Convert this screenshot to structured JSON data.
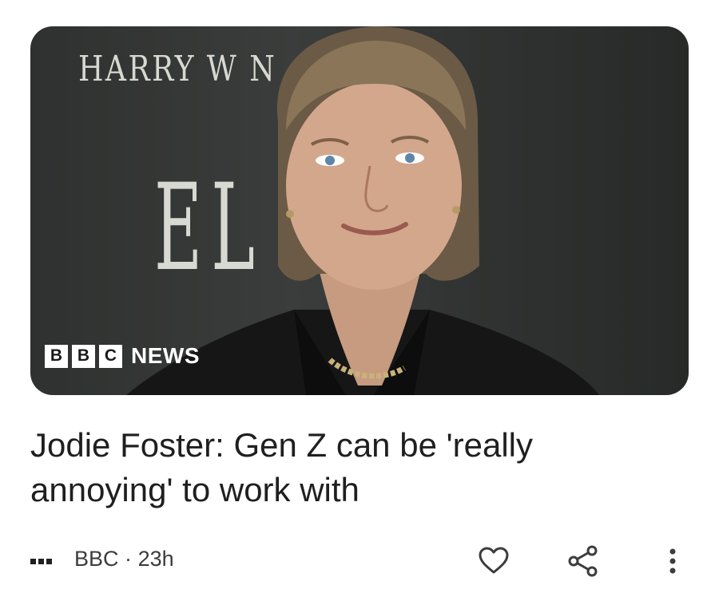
{
  "image": {
    "backdrop_text_top": "HARRY W    N",
    "backdrop_text_large": "EL",
    "logo_blocks": [
      "B",
      "B",
      "C"
    ],
    "logo_word": "NEWS"
  },
  "article": {
    "headline": "Jodie Foster: Gen Z can be 'really annoying' to work with",
    "source": "BBC",
    "separator": "·",
    "age": "23h"
  },
  "actions": {
    "like_icon": "heart-icon",
    "share_icon": "share-icon",
    "more_icon": "more-vert-icon"
  },
  "colors": {
    "text": "#1f1f1f",
    "meta_text": "#3c3c3c",
    "image_background": "#34373a"
  }
}
